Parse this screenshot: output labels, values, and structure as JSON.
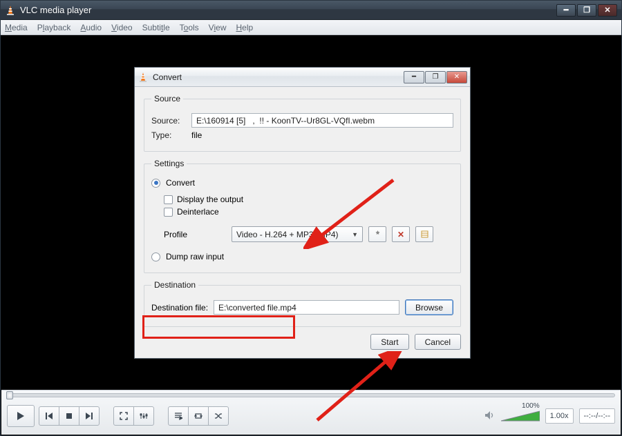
{
  "app": {
    "title": "VLC media player"
  },
  "menu": {
    "media": "Media",
    "playback": "Playback",
    "audio": "Audio",
    "video": "Video",
    "subtitle": "Subtitle",
    "tools": "Tools",
    "view": "View",
    "help": "Help"
  },
  "player": {
    "volume_pct": "100%",
    "rate": "1.00x",
    "time": "--:--/--:--"
  },
  "dialog": {
    "title": "Convert",
    "source": {
      "legend": "Source",
      "label": "Source:",
      "value": "E:\\160914 [5]   ,  !! - KoonTV--Ur8GL-VQfI.webm",
      "type_label": "Type:",
      "type_value": "file"
    },
    "settings": {
      "legend": "Settings",
      "convert_label": "Convert",
      "display_output": "Display the output",
      "deinterlace": "Deinterlace",
      "profile_label": "Profile",
      "profile_value": "Video - H.264 + MP3 (MP4)",
      "dump_raw": "Dump raw input"
    },
    "destination": {
      "legend": "Destination",
      "label": "Destination file:",
      "value": "E:\\converted file.mp4",
      "browse": "Browse"
    },
    "start": "Start",
    "cancel": "Cancel"
  }
}
